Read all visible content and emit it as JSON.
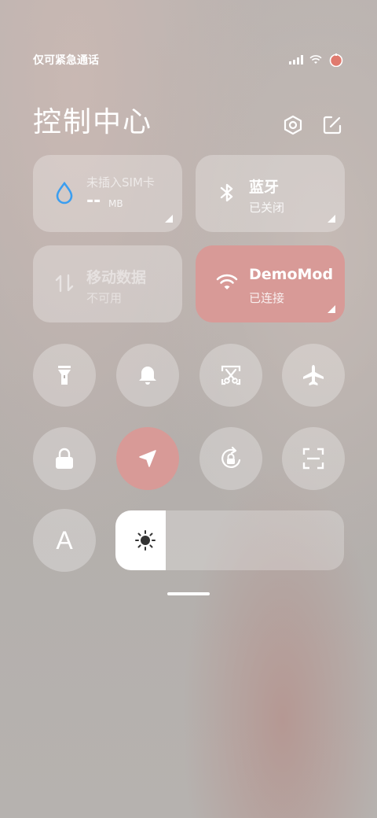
{
  "status_bar": {
    "carrier_text": "仅可紧急通话",
    "icons": [
      "signal-icon",
      "wifi-icon",
      "battery-icon"
    ]
  },
  "header": {
    "title": "控制中心",
    "actions": [
      "settings-icon",
      "edit-icon"
    ]
  },
  "tiles": [
    {
      "id": "data-usage",
      "icon": "water-drop-icon",
      "title": "未插入SIM卡",
      "value": "--",
      "unit": "MB",
      "state": "normal"
    },
    {
      "id": "bluetooth",
      "icon": "bluetooth-icon",
      "title": "蓝牙",
      "sub": "已关闭",
      "state": "normal"
    },
    {
      "id": "mobile-data",
      "icon": "mobile-data-icon",
      "title": "移动数据",
      "sub": "不可用",
      "state": "disabled"
    },
    {
      "id": "wifi",
      "icon": "wifi-icon",
      "title": "DemoMod",
      "sub": "已连接",
      "state": "active"
    }
  ],
  "toggles_row1": [
    "flashlight-icon",
    "bell-icon",
    "screenshot-icon",
    "airplane-icon"
  ],
  "toggles_row2": [
    "lock-icon",
    "location-icon",
    "rotation-lock-icon",
    "scan-icon"
  ],
  "font_button": {
    "label": "A"
  },
  "brightness": {
    "level_fraction": 0.22
  },
  "colors": {
    "accent": "#d89a97"
  }
}
